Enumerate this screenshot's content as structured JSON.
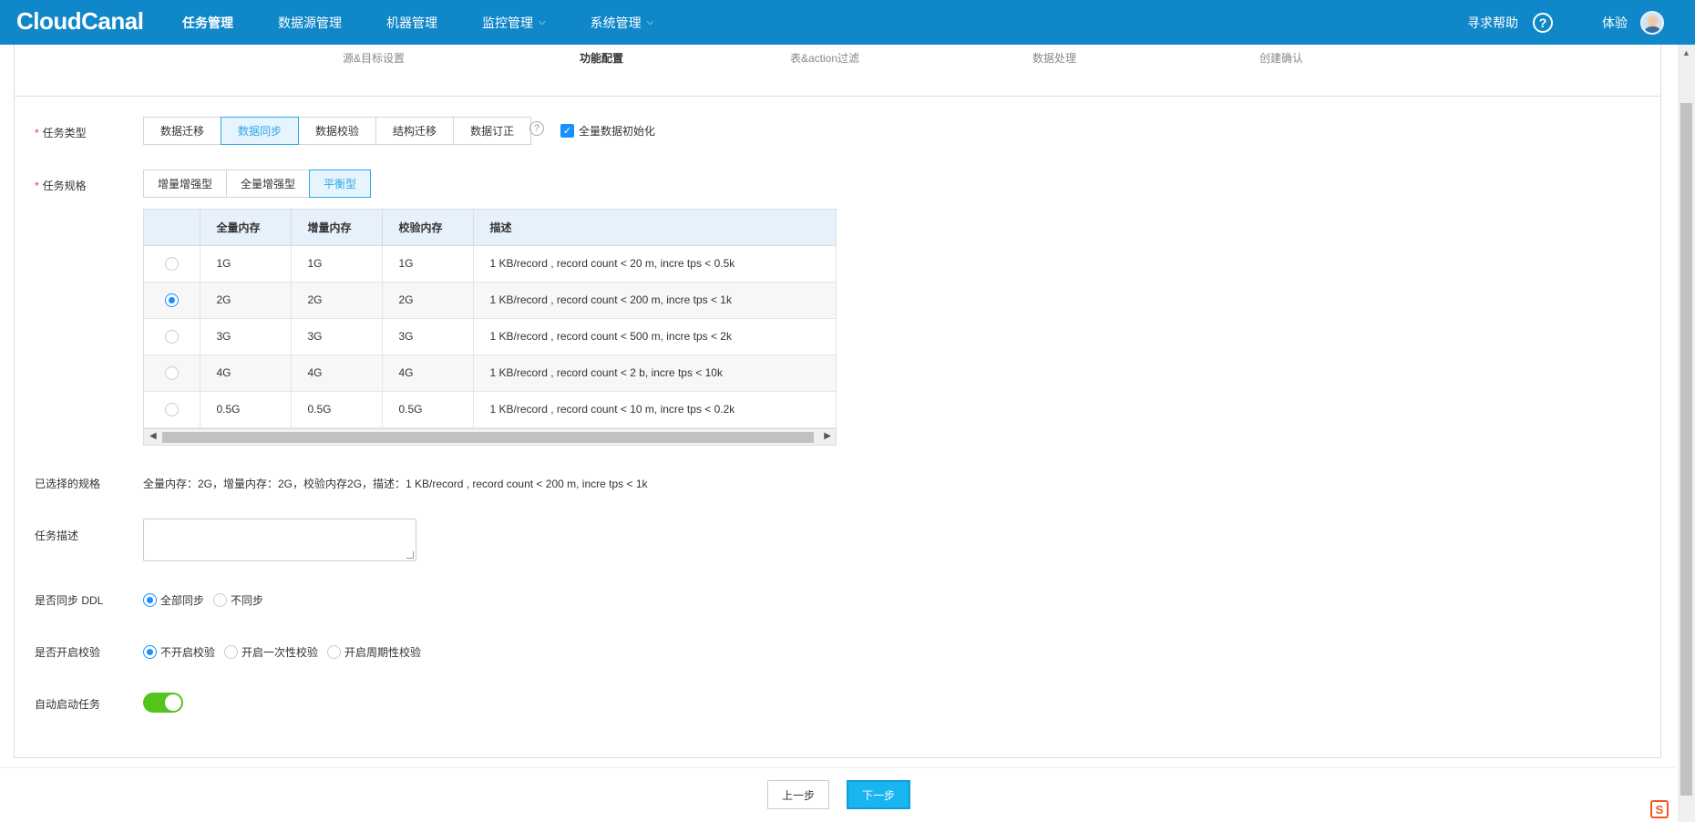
{
  "app": {
    "logo_text": "CloudCanal",
    "brand_color": "#0f87c9",
    "accent_color": "#1890ff"
  },
  "nav": {
    "items": [
      {
        "label": "任务管理",
        "active": true
      },
      {
        "label": "数据源管理"
      },
      {
        "label": "机器管理"
      },
      {
        "label": "监控管理",
        "has_dropdown": true
      },
      {
        "label": "系统管理",
        "has_dropdown": true
      }
    ],
    "help_label": "寻求帮助",
    "help_icon": "question-circle-icon",
    "user_name": "体验"
  },
  "steps": [
    "源&目标设置",
    "功能配置",
    "表&action过滤",
    "数据处理",
    "创建确认"
  ],
  "form": {
    "task_type": {
      "label": "任务类型",
      "options": [
        "数据迁移",
        "数据同步",
        "数据校验",
        "结构迁移",
        "数据订正"
      ],
      "selected": "数据同步",
      "full_init_label": "全量数据初始化",
      "full_init_checked": true
    },
    "task_spec": {
      "label": "任务规格",
      "options": [
        "增量增强型",
        "全量增强型",
        "平衡型"
      ],
      "selected": "平衡型",
      "table": {
        "headers": [
          "",
          "全量内存",
          "增量内存",
          "校验内存",
          "描述"
        ],
        "rows": [
          {
            "selected": false,
            "full": "1G",
            "incr": "1G",
            "check": "1G",
            "desc": "1 KB/record , record count < 20 m, incre tps < 0.5k"
          },
          {
            "selected": true,
            "full": "2G",
            "incr": "2G",
            "check": "2G",
            "desc": "1 KB/record , record count < 200 m, incre tps < 1k"
          },
          {
            "selected": false,
            "full": "3G",
            "incr": "3G",
            "check": "3G",
            "desc": "1 KB/record , record count < 500 m, incre tps < 2k"
          },
          {
            "selected": false,
            "full": "4G",
            "incr": "4G",
            "check": "4G",
            "desc": "1 KB/record , record count < 2 b, incre tps < 10k"
          },
          {
            "selected": false,
            "full": "0.5G",
            "incr": "0.5G",
            "check": "0.5G",
            "desc": "1 KB/record , record count < 10 m, incre tps < 0.2k"
          }
        ]
      }
    },
    "selected_spec": {
      "label": "已选择的规格",
      "value": "全量内存：2G，增量内存：2G，校验内存2G，描述：1 KB/record , record count < 200 m, incre tps < 1k"
    },
    "task_desc": {
      "label": "任务描述",
      "value": ""
    },
    "sync_ddl": {
      "label": "是否同步 DDL",
      "options": [
        "全部同步",
        "不同步"
      ],
      "selected": "全部同步"
    },
    "enable_check": {
      "label": "是否开启校验",
      "options": [
        "不开启校验",
        "开启一次性校验",
        "开启周期性校验"
      ],
      "selected": "不开启校验"
    },
    "auto_start": {
      "label": "自动启动任务",
      "on": true
    }
  },
  "footer": {
    "prev_label": "上一步",
    "next_label": "下一步"
  }
}
